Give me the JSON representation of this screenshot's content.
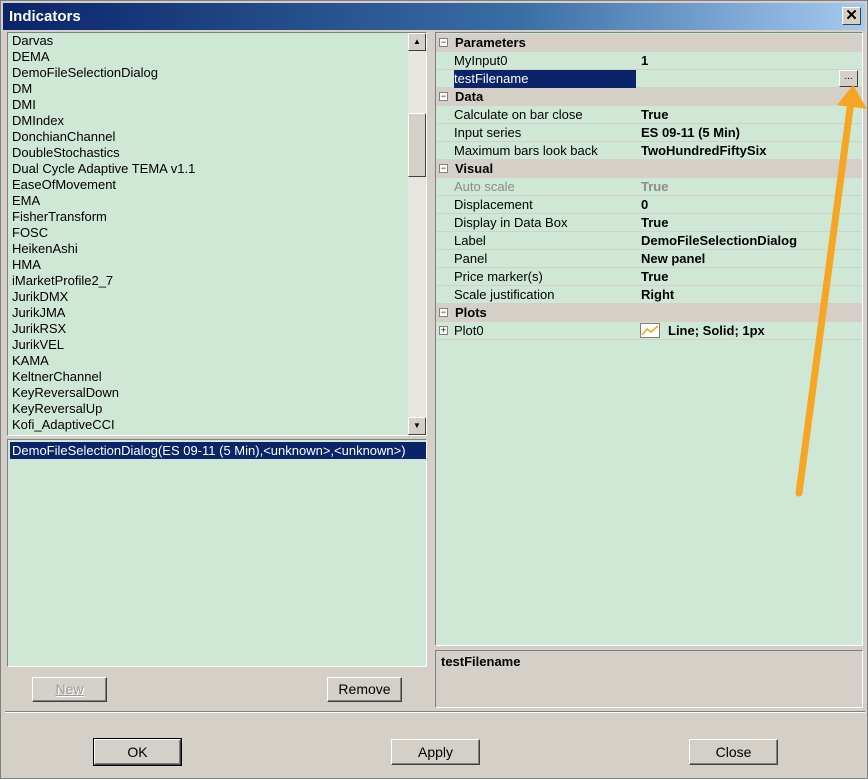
{
  "window": {
    "title": "Indicators",
    "close_glyph": "✕"
  },
  "indicator_list": {
    "items": [
      "Darvas",
      "DEMA",
      "DemoFileSelectionDialog",
      "DM",
      "DMI",
      "DMIndex",
      "DonchianChannel",
      "DoubleStochastics",
      "Dual Cycle Adaptive TEMA v1.1",
      "EaseOfMovement",
      "EMA",
      "FisherTransform",
      "FOSC",
      "HeikenAshi",
      "HMA",
      "iMarketProfile2_7",
      "JurikDMX",
      "JurikJMA",
      "JurikRSX",
      "JurikVEL",
      "KAMA",
      "KeltnerChannel",
      "KeyReversalDown",
      "KeyReversalUp",
      "Kofi_AdaptiveCCI"
    ],
    "scroll_up_icon": "▲",
    "scroll_down_icon": "▼"
  },
  "applied": {
    "items": [
      "DemoFileSelectionDialog(ES 09-11 (5 Min),<unknown>,<unknown>)"
    ]
  },
  "left_buttons": {
    "new_label": "New",
    "remove_label": "Remove"
  },
  "properties": {
    "categories": {
      "parameters": "Parameters",
      "data": "Data",
      "visual": "Visual",
      "plots": "Plots"
    },
    "toggle_minus": "−",
    "toggle_plus": "+",
    "rows": {
      "myinput0": {
        "name": "MyInput0",
        "value": "1"
      },
      "testfilename": {
        "name": "testFilename",
        "value": "",
        "button": "..."
      },
      "calc_on_bar_close": {
        "name": "Calculate on bar close",
        "value": "True"
      },
      "input_series": {
        "name": "Input series",
        "value": "ES 09-11 (5 Min)"
      },
      "max_bars": {
        "name": "Maximum bars look back",
        "value": "TwoHundredFiftySix"
      },
      "auto_scale": {
        "name": "Auto scale",
        "value": "True"
      },
      "displacement": {
        "name": "Displacement",
        "value": "0"
      },
      "display_in_databox": {
        "name": "Display in Data Box",
        "value": "True"
      },
      "label": {
        "name": "Label",
        "value": "DemoFileSelectionDialog"
      },
      "panel": {
        "name": "Panel",
        "value": "New panel"
      },
      "price_marker": {
        "name": "Price marker(s)",
        "value": "True"
      },
      "scale_justification": {
        "name": "Scale justification",
        "value": "Right"
      },
      "plot0": {
        "name": "Plot0",
        "value": "Line; Solid; 1px"
      }
    }
  },
  "description": {
    "title": "testFilename"
  },
  "footer": {
    "ok_label": "OK",
    "apply_label": "Apply",
    "close_label": "Close"
  },
  "colors": {
    "grid_background": "#cfe8d6",
    "selection": "#0a246a",
    "annotation_arrow": "#f5a623"
  }
}
